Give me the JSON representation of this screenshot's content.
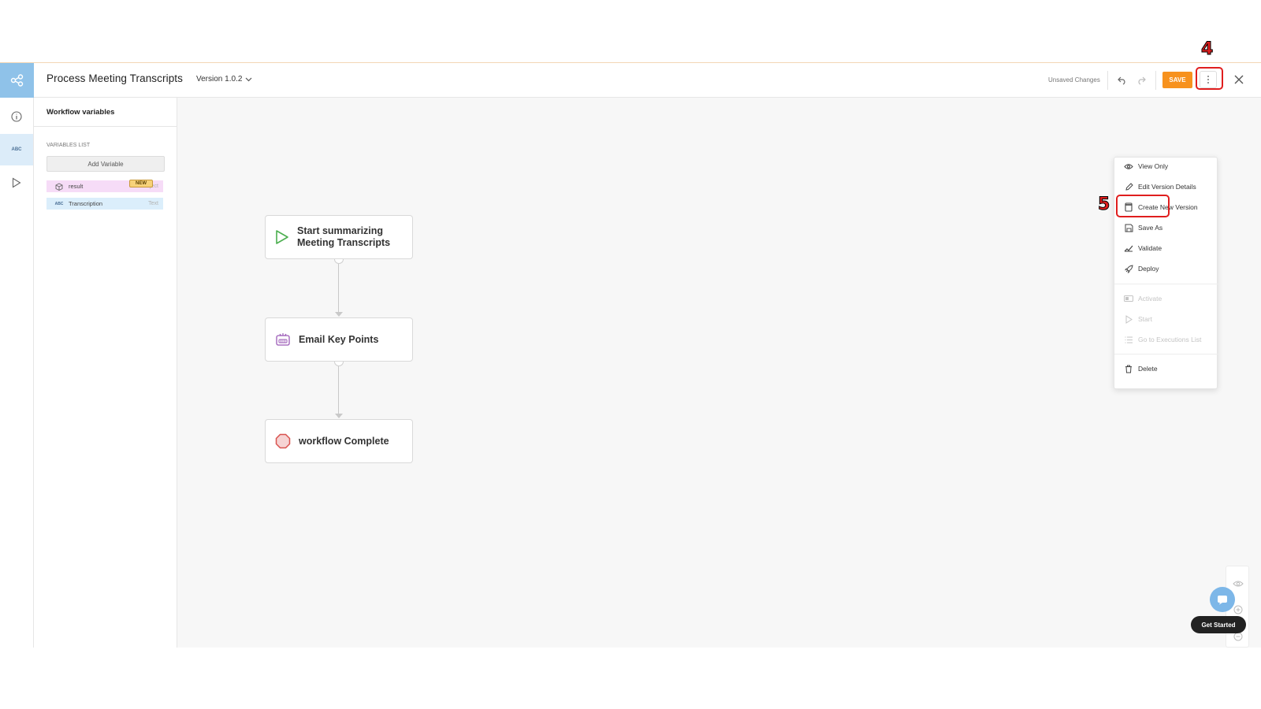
{
  "header": {
    "title": "Process Meeting Transcripts",
    "version": "Version 1.0.2",
    "unsaved": "Unsaved Changes",
    "save_label": "SAVE"
  },
  "rail": {
    "abc_label": "ABC"
  },
  "variables": {
    "panel_title": "Workflow variables",
    "list_label": "VARIABLES LIST",
    "add_label": "Add Variable",
    "new_badge": "NEW",
    "items": [
      {
        "name": "result",
        "type": "Object"
      },
      {
        "name": "Transcription",
        "type": "Text"
      }
    ]
  },
  "nodes": {
    "start_line1": "Start summarizing",
    "start_line2": "Meeting Transcripts",
    "email": "Email Key Points",
    "complete": "workflow Complete"
  },
  "menu": {
    "items": [
      {
        "label": "View Only",
        "enabled": true
      },
      {
        "label": "Edit Version Details",
        "enabled": true
      },
      {
        "label": "Create New Version",
        "enabled": true
      },
      {
        "label": "Save As",
        "enabled": true
      },
      {
        "label": "Validate",
        "enabled": true
      },
      {
        "label": "Deploy",
        "enabled": true
      },
      {
        "label": "Activate",
        "enabled": false
      },
      {
        "label": "Start",
        "enabled": false
      },
      {
        "label": "Go to Executions List",
        "enabled": false
      },
      {
        "label": "Delete",
        "enabled": true
      }
    ]
  },
  "annotations": {
    "step_more": "4",
    "step_deploy": "5"
  },
  "help": {
    "get_started": "Get Started"
  },
  "colors": {
    "accent": "#f7921e",
    "rail_active": "#8fc2e9",
    "annotation": "#e01e1e"
  }
}
